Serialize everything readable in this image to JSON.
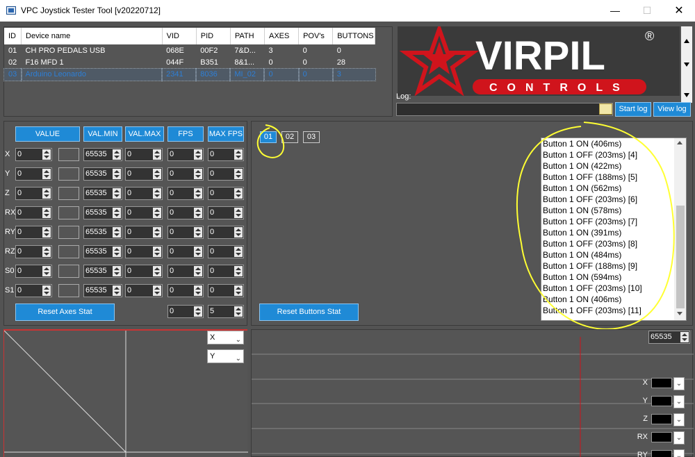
{
  "window": {
    "title": "VPC Joystick Tester Tool [v20220712]",
    "minimize": "—",
    "maximize": "☐",
    "close": "✕"
  },
  "devices": {
    "headers": [
      "ID",
      "Device name",
      "VID",
      "PID",
      "PATH",
      "AXES",
      "POV's",
      "BUTTONS"
    ],
    "rows": [
      [
        "01",
        "CH PRO PEDALS USB",
        "068E",
        "00F2",
        "7&D...",
        "3",
        "0",
        "0"
      ],
      [
        "02",
        "F16 MFD 1",
        "044F",
        "B351",
        "8&1...",
        "0",
        "0",
        "28"
      ],
      [
        "03",
        "Arduino Leonardo",
        "2341",
        "8036",
        "MI_02",
        "0",
        "0",
        "3"
      ]
    ],
    "selected_index": 2
  },
  "logo": {
    "brand": "VIRPIL",
    "registered": "®",
    "tagline": "CONTROLS"
  },
  "log": {
    "label": "Log:",
    "value": "",
    "start_label": "Start log",
    "view_label": "View log"
  },
  "axes": {
    "headers": {
      "value": "VALUE",
      "val_min": "VAL.MIN",
      "val_max": "VAL.MAX",
      "fps": "FPS",
      "max_fps": "MAX FPS"
    },
    "rows": [
      {
        "label": "X",
        "value": "0",
        "val_min": "65535",
        "val_max": "0",
        "fps": "0",
        "max_fps": "0"
      },
      {
        "label": "Y",
        "value": "0",
        "val_min": "65535",
        "val_max": "0",
        "fps": "0",
        "max_fps": "0"
      },
      {
        "label": "Z",
        "value": "0",
        "val_min": "65535",
        "val_max": "0",
        "fps": "0",
        "max_fps": "0"
      },
      {
        "label": "RX",
        "value": "0",
        "val_min": "65535",
        "val_max": "0",
        "fps": "0",
        "max_fps": "0"
      },
      {
        "label": "RY",
        "value": "0",
        "val_min": "65535",
        "val_max": "0",
        "fps": "0",
        "max_fps": "0"
      },
      {
        "label": "RZ",
        "value": "0",
        "val_min": "65535",
        "val_max": "0",
        "fps": "0",
        "max_fps": "0"
      },
      {
        "label": "S0",
        "value": "0",
        "val_min": "65535",
        "val_max": "0",
        "fps": "0",
        "max_fps": "0"
      },
      {
        "label": "S1",
        "value": "0",
        "val_min": "65535",
        "val_max": "0",
        "fps": "0",
        "max_fps": "0"
      }
    ],
    "reset_label": "Reset Axes Stat",
    "fps_total": "0",
    "max_fps_total": "5"
  },
  "buttons": {
    "tabs": [
      "01",
      "02",
      "03"
    ],
    "active_tab": "01",
    "reset_label": "Reset Buttons Stat",
    "events": [
      "Button 1 ON (406ms)",
      "Button 1 OFF (203ms) [4]",
      "Button 1 ON (422ms)",
      "Button 1 OFF (188ms) [5]",
      "Button 1 ON (562ms)",
      "Button 1 OFF (203ms) [6]",
      "Button 1 ON (578ms)",
      "Button 1 OFF (203ms) [7]",
      "Button 1 ON (391ms)",
      "Button 1 OFF (203ms) [8]",
      "Button 1 ON (484ms)",
      "Button 1 OFF (188ms) [9]",
      "Button 1 ON (594ms)",
      "Button 1 OFF (203ms) [10]",
      "Button 1 ON (406ms)",
      "Button 1 OFF (203ms) [11]"
    ]
  },
  "xy_plot": {
    "x_axis": "X",
    "y_axis": "Y"
  },
  "time_plot": {
    "max_value": "65535",
    "channels": [
      "X",
      "Y",
      "Z",
      "RX",
      "RY"
    ]
  },
  "colors": {
    "accent": "#1f8ad6",
    "panel": "#555555",
    "logo_red": "#d0141c",
    "annotation": "#ffff33"
  }
}
